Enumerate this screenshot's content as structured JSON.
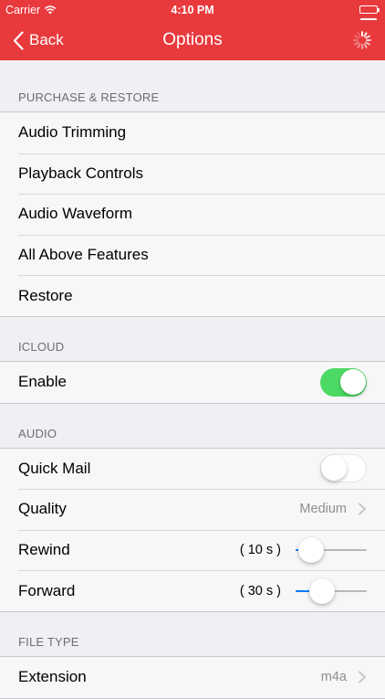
{
  "status": {
    "carrier": "Carrier",
    "time": "4:10 PM"
  },
  "nav": {
    "back_label": "Back",
    "title": "Options"
  },
  "sections": {
    "purchase": {
      "header": "PURCHASE & RESTORE",
      "items": [
        "Audio Trimming",
        "Playback Controls",
        "Audio Waveform",
        "All Above Features",
        "Restore"
      ]
    },
    "icloud": {
      "header": "ICLOUD",
      "enable_label": "Enable",
      "enable_on": true
    },
    "audio": {
      "header": "AUDIO",
      "quick_mail_label": "Quick Mail",
      "quick_mail_on": false,
      "quality_label": "Quality",
      "quality_value": "Medium",
      "rewind_label": "Rewind",
      "rewind_value": "( 10 s )",
      "rewind_fraction": 0.05,
      "forward_label": "Forward",
      "forward_value": "( 30 s )",
      "forward_fraction": 0.3
    },
    "file_type": {
      "header": "FILE TYPE",
      "extension_label": "Extension",
      "extension_value": "m4a"
    }
  },
  "colors": {
    "accent": "#e8393d",
    "switch_on": "#4cd964",
    "slider_fill": "#007aff"
  },
  "icons": [
    "wifi-icon",
    "battery-icon",
    "back-chevron-icon",
    "activity-spinner-icon",
    "chevron-right-icon"
  ]
}
